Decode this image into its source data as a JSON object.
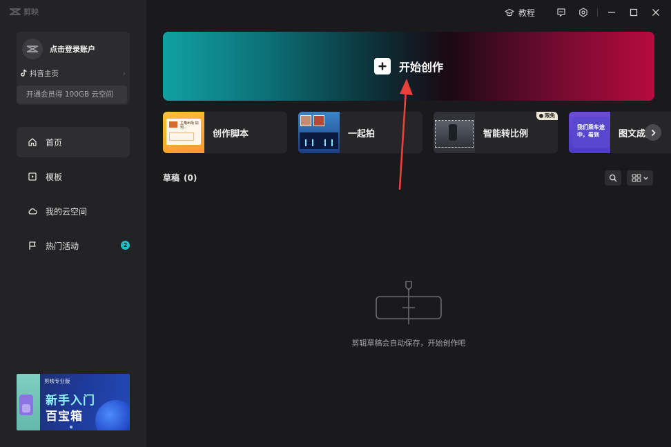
{
  "app": {
    "name": "剪映"
  },
  "titlebar": {
    "tutorial_label": "教程"
  },
  "account": {
    "login_text": "点击登录账户",
    "douyin_label": "抖音主页",
    "member_text": "开通会员得 100GB 云空间"
  },
  "nav": {
    "items": [
      {
        "label": "首页"
      },
      {
        "label": "模板"
      },
      {
        "label": "我的云空间"
      },
      {
        "label": "热门活动",
        "badge": "2"
      }
    ]
  },
  "promo": {
    "brand": "剪映专业版",
    "line1": "新手入门",
    "line2": "百宝箱"
  },
  "hero": {
    "label": "开始创作"
  },
  "tools": [
    {
      "label": "创作脚本",
      "thumb_text": "主角出场 如何..."
    },
    {
      "label": "一起拍"
    },
    {
      "label": "智能转比例",
      "badge": "限免"
    },
    {
      "label": "图文成片",
      "thumb_text": "我们乘车途中，看到"
    }
  ],
  "drafts": {
    "title": "草稿",
    "count": "(0)"
  },
  "empty": {
    "message": "剪辑草稿会自动保存，开始创作吧"
  },
  "colors": {
    "accent": "#1dbfc6",
    "hero_left": "#11a1a3",
    "hero_right": "#b80a3f",
    "annotation": "#e8403a"
  }
}
